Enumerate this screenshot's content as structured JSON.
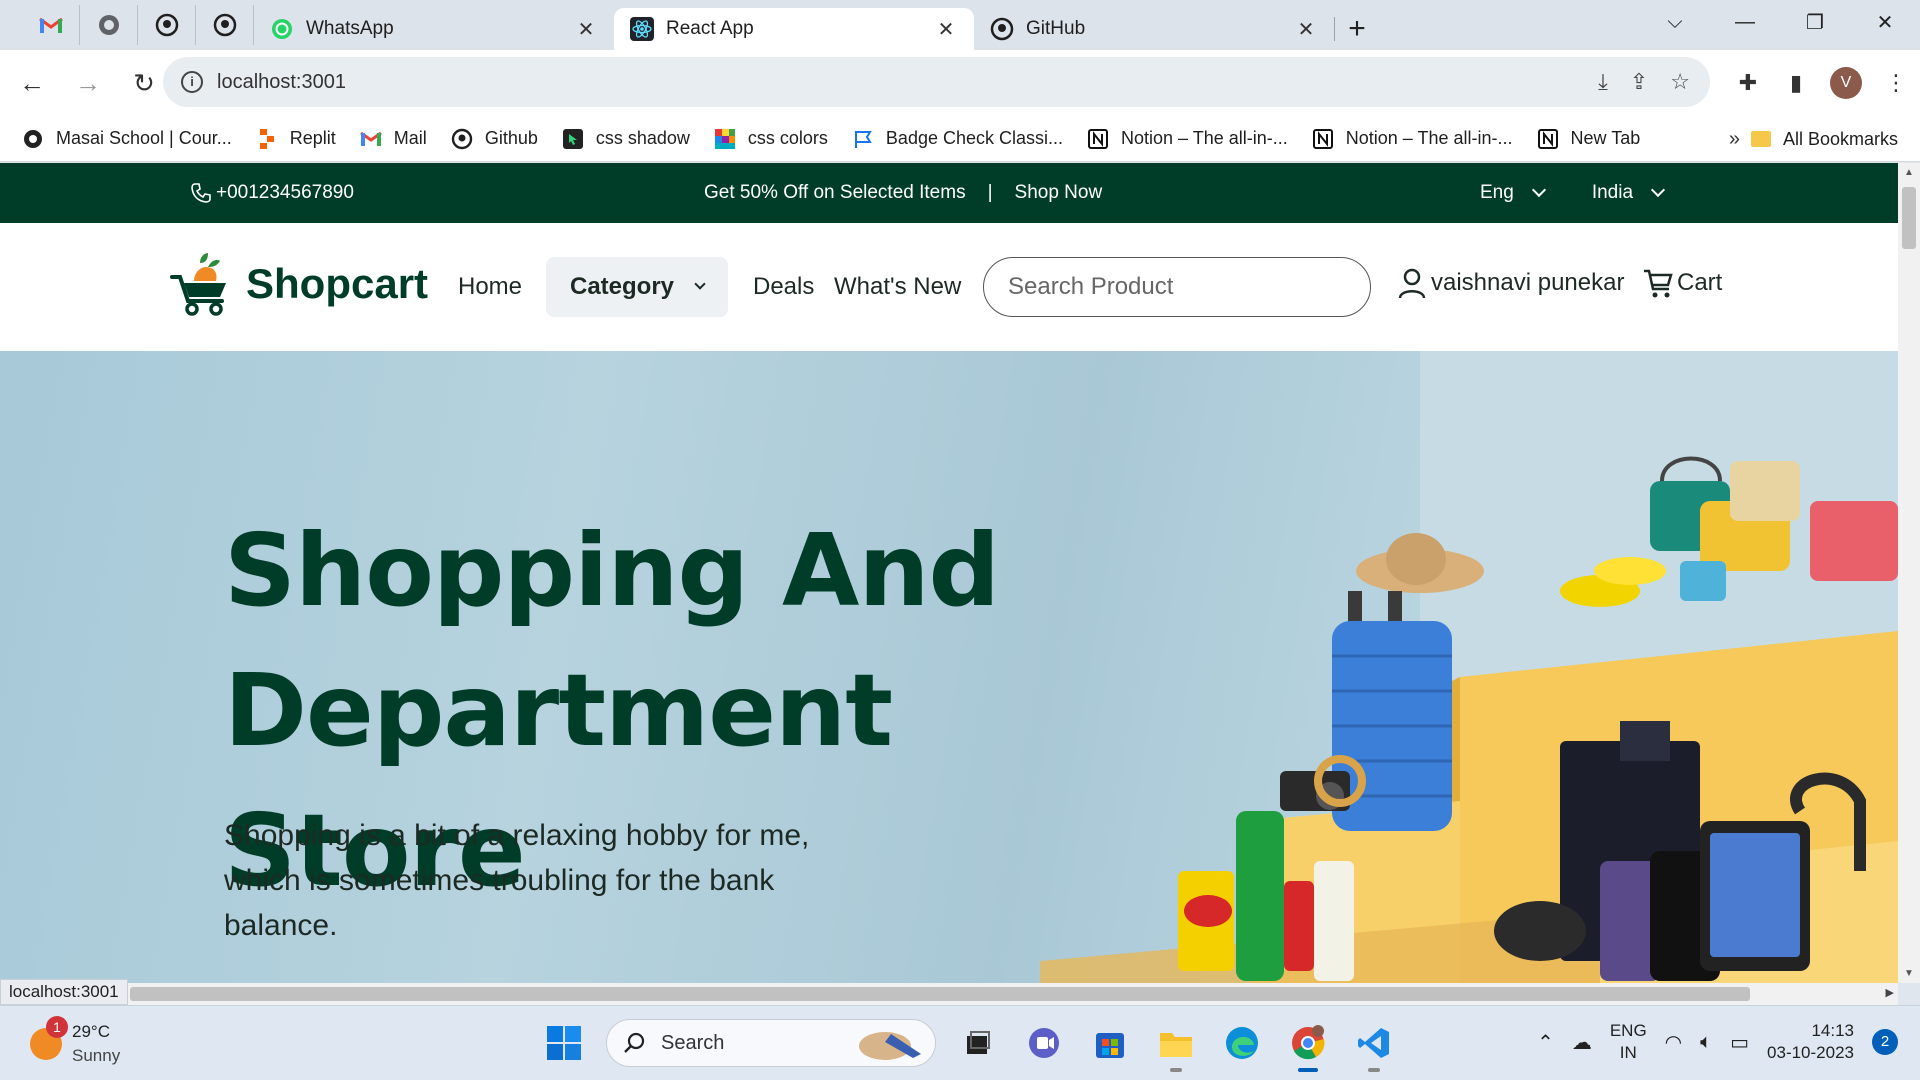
{
  "browser": {
    "tabs": [
      {
        "title": "WhatsApp",
        "active": false
      },
      {
        "title": "React App",
        "active": true
      },
      {
        "title": "GitHub",
        "active": false
      }
    ],
    "pinned_icons": [
      "gmail-icon",
      "globe-icon",
      "github-icon",
      "github-icon"
    ],
    "url": "localhost:3001",
    "profile_initial": "V",
    "status_url": "localhost:3001",
    "bookmarks": [
      {
        "label": "Masai School | Cour...",
        "icon": "masai-icon"
      },
      {
        "label": "Replit",
        "icon": "replit-icon"
      },
      {
        "label": "Mail",
        "icon": "gmail-icon"
      },
      {
        "label": "Github",
        "icon": "github-icon"
      },
      {
        "label": "css shadow",
        "icon": "cursor-icon"
      },
      {
        "label": "css colors",
        "icon": "palette-icon"
      },
      {
        "label": "Badge Check Classi...",
        "icon": "flag-icon"
      },
      {
        "label": "Notion – The all-in-...",
        "icon": "notion-icon"
      },
      {
        "label": "Notion – The all-in-...",
        "icon": "notion-icon"
      },
      {
        "label": "New Tab",
        "icon": "notion-icon"
      }
    ],
    "bookmarks_overflow": "»",
    "all_bookmarks": "All Bookmarks"
  },
  "site": {
    "promo": {
      "phone": "+001234567890",
      "offer": "Get 50% Off on Selected Items",
      "divider": "|",
      "shop_now": "Shop Now",
      "language": "Eng",
      "country": "India"
    },
    "nav": {
      "brand": "Shopcart",
      "home": "Home",
      "category": "Category",
      "deals": "Deals",
      "whats_new": "What's New",
      "search_placeholder": "Search Product",
      "user": "vaishnavi punekar",
      "cart": "Cart"
    },
    "hero": {
      "title": "Shopping And Department Store",
      "subtitle": "Shopping is a bit of a relaxing hobby for me, which is sometimes troubling for the bank balance."
    },
    "colors": {
      "brand_dark_green": "#003d29",
      "hero_bg": "#a9c8d6",
      "accent_yellow": "#f3c552"
    }
  },
  "taskbar": {
    "weather": {
      "temp": "29°C",
      "condition": "Sunny",
      "badge": "1"
    },
    "search_label": "Search",
    "language": "ENG",
    "region": "IN",
    "time": "14:13",
    "date": "03-10-2023",
    "notifications": "2"
  }
}
